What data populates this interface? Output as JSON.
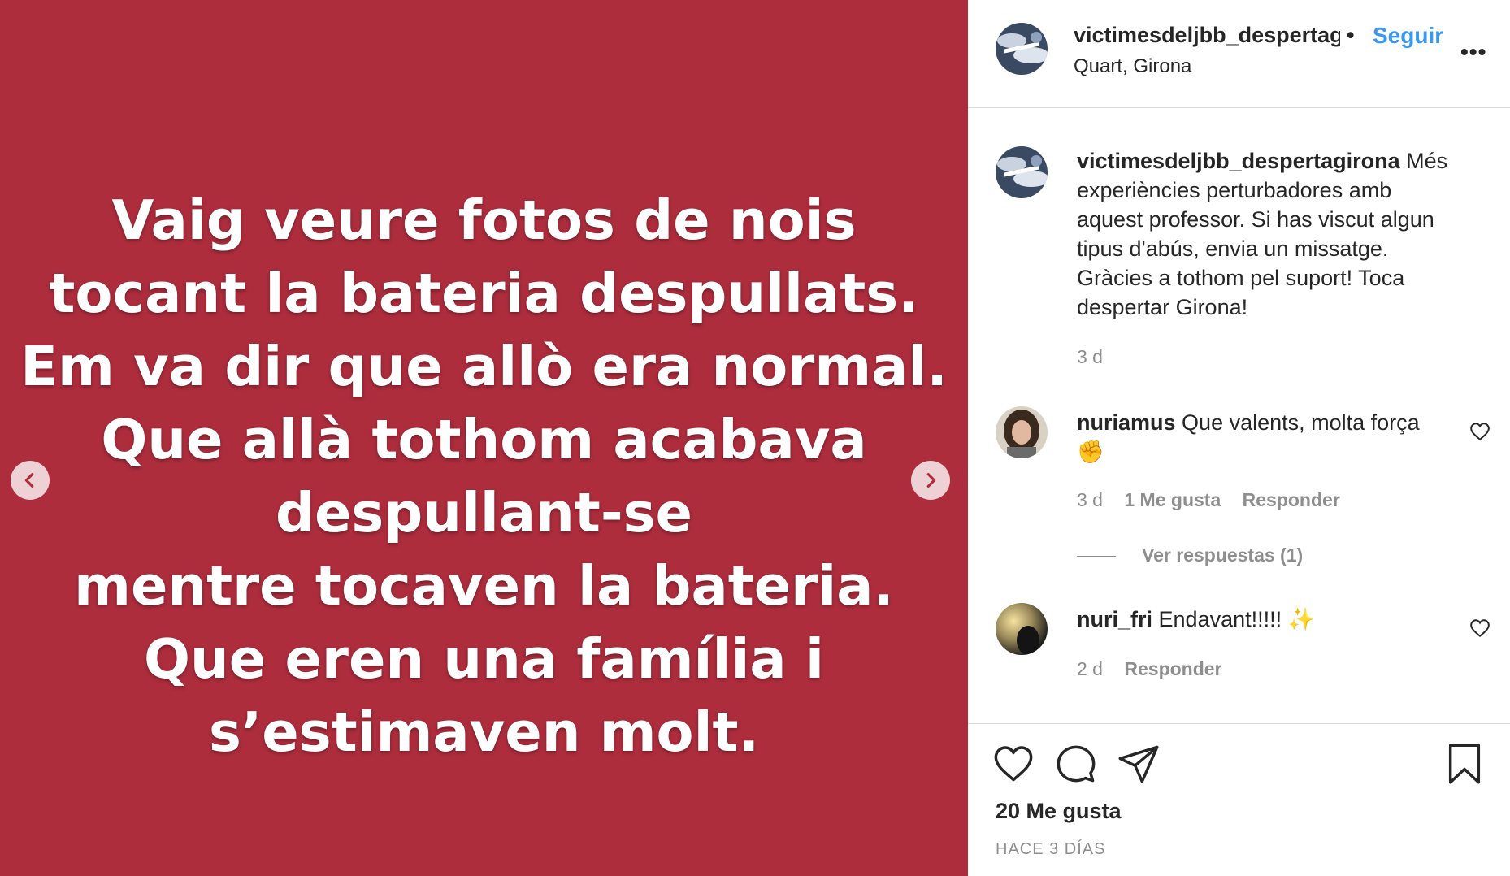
{
  "post_image": {
    "lines": [
      "Vaig veure fotos de nois",
      "tocant la bateria despullats.",
      "Em va dir que allò era normal.",
      "Que allà tothom acabava",
      "despullant-se",
      "mentre tocaven la bateria.",
      "Que eren una família i",
      "s’estimaven molt."
    ],
    "background_color": "#ad2d3d"
  },
  "header": {
    "username": "victimesdeljbb_despertagirona",
    "separator": "•",
    "follow_label": "Seguir",
    "location": "Quart, Girona",
    "more_label": "•••"
  },
  "caption": {
    "username": "victimesdeljbb_despertagirona",
    "text": "Més experiències perturbadores amb aquest professor. Si has viscut algun tipus d'abús, envia un missatge. Gràcies a tothom pel suport! Toca despertar Girona!",
    "time": "3 d"
  },
  "comments": [
    {
      "username": "nuriamus",
      "text": "Que valents, molta força",
      "emoji": "✊",
      "time": "3 d",
      "likes": "1 Me gusta",
      "reply_label": "Responder",
      "view_replies": "Ver respuestas (1)"
    },
    {
      "username": "nuri_fri",
      "text": "Endavant!!!!!",
      "emoji": "✨",
      "time": "2 d",
      "reply_label": "Responder"
    }
  ],
  "footer": {
    "likes_count": "20 Me gusta",
    "posted": "HACE 3 DÍAS"
  },
  "icons": {
    "prev": "chevron-left-icon",
    "next": "chevron-right-icon",
    "like": "heart-icon",
    "comment": "comment-bubble-icon",
    "share": "paper-plane-icon",
    "save": "bookmark-icon"
  },
  "colors": {
    "accent": "#3897f0",
    "muted": "#8e8e8e",
    "border": "#dbdbdb"
  }
}
